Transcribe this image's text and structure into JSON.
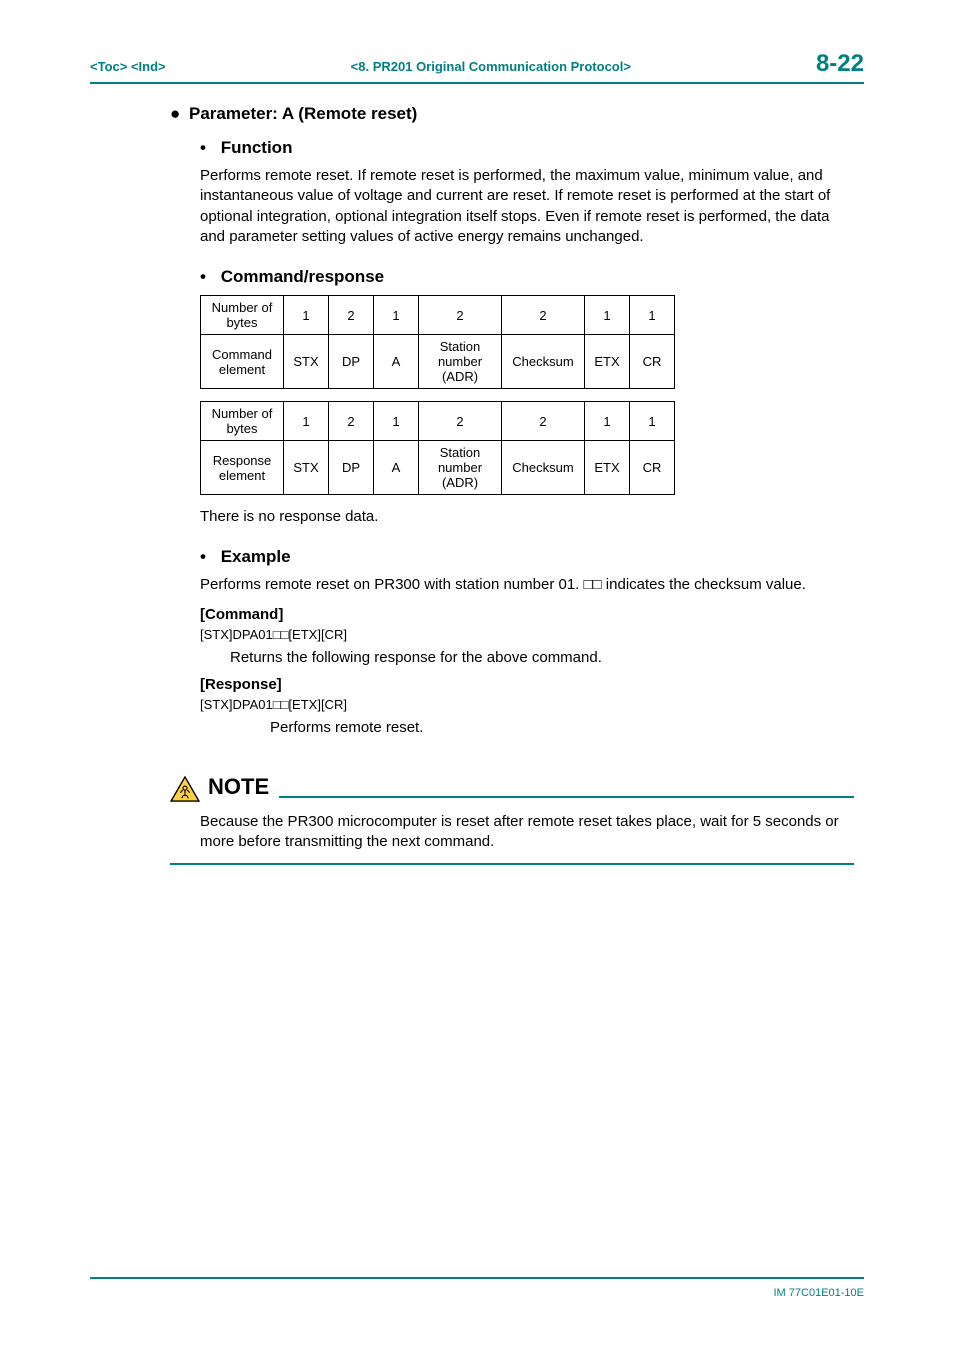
{
  "header": {
    "toc": "<Toc>",
    "ind": "<Ind>",
    "chapter": "<8.  PR201 Original Communication Protocol>",
    "page": "8-22"
  },
  "section": {
    "param_title": "Parameter: A (Remote reset)",
    "function": {
      "heading": "Function",
      "text": "Performs remote reset. If remote reset is performed, the maximum value, minimum value, and instantaneous value of voltage and current are reset. If remote reset is performed at the start of optional integration, optional integration itself stops. Even if remote reset is performed, the data and parameter setting values of active energy remains unchanged."
    },
    "cmdresp": {
      "heading": "Command/response",
      "no_response": "There is no response data."
    },
    "example": {
      "heading": "Example",
      "intro": "Performs remote reset on PR300 with station number 01. □□ indicates the checksum value.",
      "command_label": "[Command]",
      "command_line": "[STX]DPA01□□[ETX][CR]",
      "command_returns": "Returns the following response for the above command.",
      "response_label": "[Response]",
      "response_line": "[STX]DPA01□□[ETX][CR]",
      "response_action": "Performs remote reset."
    },
    "note": {
      "title": "NOTE",
      "text": "Because the PR300 microcomputer is reset after remote reset takes place, wait for 5 seconds or more before transmitting the next command."
    }
  },
  "footer": {
    "doc": "IM 77C01E01-10E"
  },
  "chart_data": [
    {
      "type": "table",
      "title": "Command frame",
      "rows": [
        [
          "Number of bytes",
          "1",
          "2",
          "1",
          "2",
          "2",
          "1",
          "1"
        ],
        [
          "Command element",
          "STX",
          "DP",
          "A",
          "Station number (ADR)",
          "Checksum",
          "ETX",
          "CR"
        ]
      ]
    },
    {
      "type": "table",
      "title": "Response frame",
      "rows": [
        [
          "Number of bytes",
          "1",
          "2",
          "1",
          "2",
          "2",
          "1",
          "1"
        ],
        [
          "Response element",
          "STX",
          "DP",
          "A",
          "Station number (ADR)",
          "Checksum",
          "ETX",
          "CR"
        ]
      ]
    }
  ]
}
